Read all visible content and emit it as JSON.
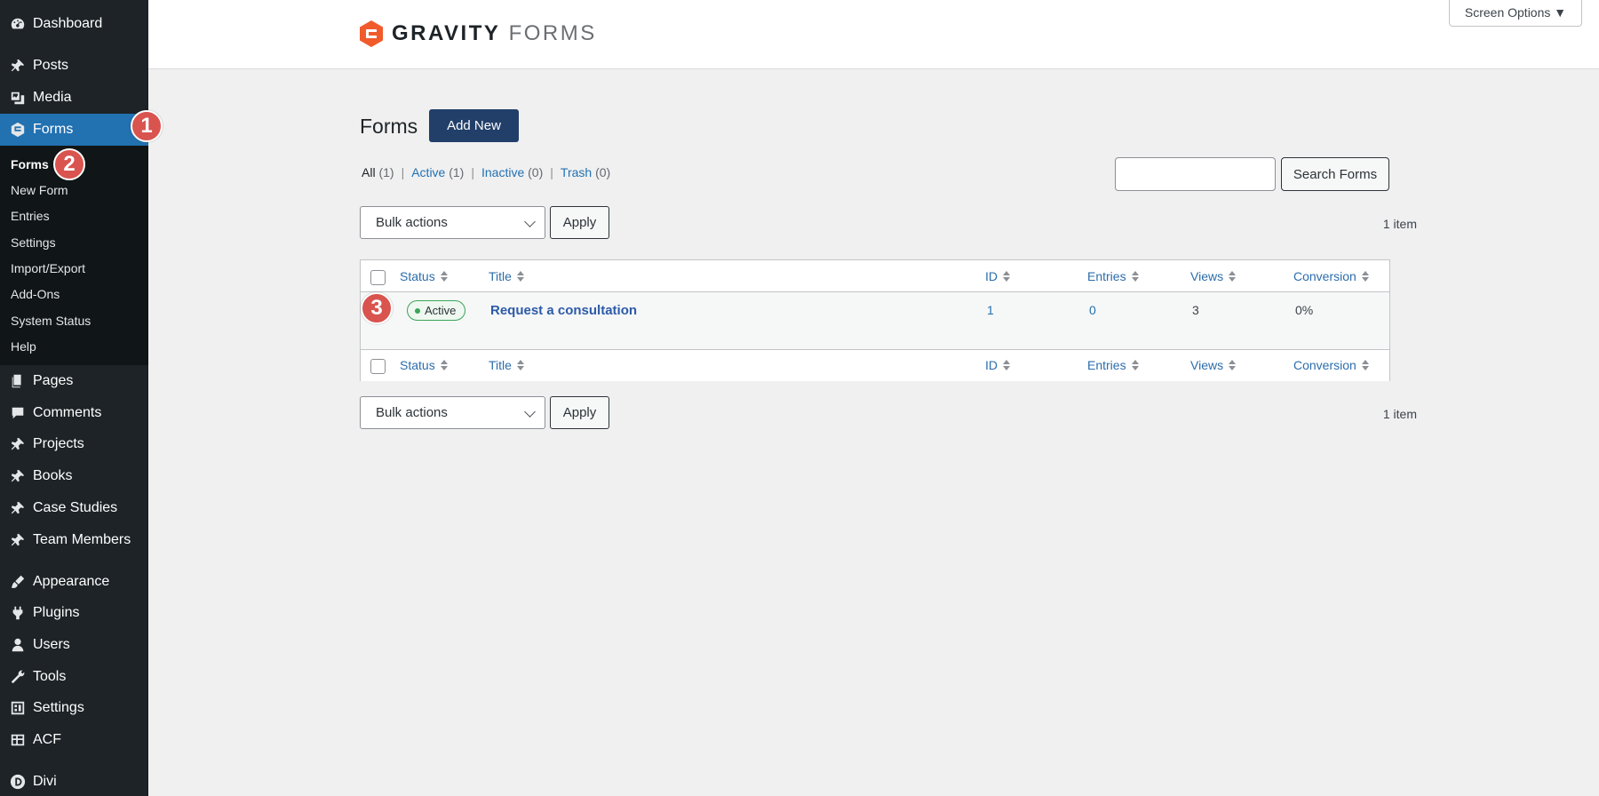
{
  "sidebar": {
    "items": [
      {
        "label": "Dashboard",
        "icon": "dashboard-icon"
      },
      {
        "label": "Posts",
        "icon": "pin-icon"
      },
      {
        "label": "Media",
        "icon": "media-icon"
      },
      {
        "label": "Forms",
        "icon": "gravity-forms-icon"
      },
      {
        "label": "Pages",
        "icon": "pages-icon"
      },
      {
        "label": "Comments",
        "icon": "comments-icon"
      },
      {
        "label": "Projects",
        "icon": "pin-icon"
      },
      {
        "label": "Books",
        "icon": "pin-icon"
      },
      {
        "label": "Case Studies",
        "icon": "pin-icon"
      },
      {
        "label": "Team Members",
        "icon": "pin-icon"
      },
      {
        "label": "Appearance",
        "icon": "brush-icon"
      },
      {
        "label": "Plugins",
        "icon": "plugin-icon"
      },
      {
        "label": "Users",
        "icon": "users-icon"
      },
      {
        "label": "Tools",
        "icon": "wrench-icon"
      },
      {
        "label": "Settings",
        "icon": "settings-icon"
      },
      {
        "label": "ACF",
        "icon": "table-icon"
      },
      {
        "label": "Divi",
        "icon": "divi-icon"
      }
    ],
    "submenu": [
      "Forms",
      "New Form",
      "Entries",
      "Settings",
      "Import/Export",
      "Add-Ons",
      "System Status",
      "Help"
    ]
  },
  "header": {
    "logo_bold": "GRAVITY",
    "logo_light": "FORMS",
    "screen_options": "Screen Options ▼"
  },
  "page": {
    "title": "Forms",
    "add_new": "Add New",
    "filters": [
      {
        "label": "All",
        "count": "(1)"
      },
      {
        "label": "Active",
        "count": "(1)"
      },
      {
        "label": "Inactive",
        "count": "(0)"
      },
      {
        "label": "Trash",
        "count": "(0)"
      }
    ],
    "search_button": "Search Forms",
    "bulk_actions": "Bulk actions",
    "apply": "Apply",
    "item_count": "1 item"
  },
  "table": {
    "columns": [
      "Status",
      "Title",
      "ID",
      "Entries",
      "Views",
      "Conversion"
    ],
    "rows": [
      {
        "status": "Active",
        "title": "Request a consultation",
        "id": "1",
        "entries": "0",
        "views": "3",
        "conversion": "0%"
      }
    ]
  },
  "steps": [
    "1",
    "2",
    "3"
  ],
  "colors": {
    "sidebar_bg": "#1d2327",
    "current_menu": "#2271b1",
    "primary_button": "#213f69",
    "step_marker": "#d9534f",
    "logo_orange": "#f15a2b"
  }
}
